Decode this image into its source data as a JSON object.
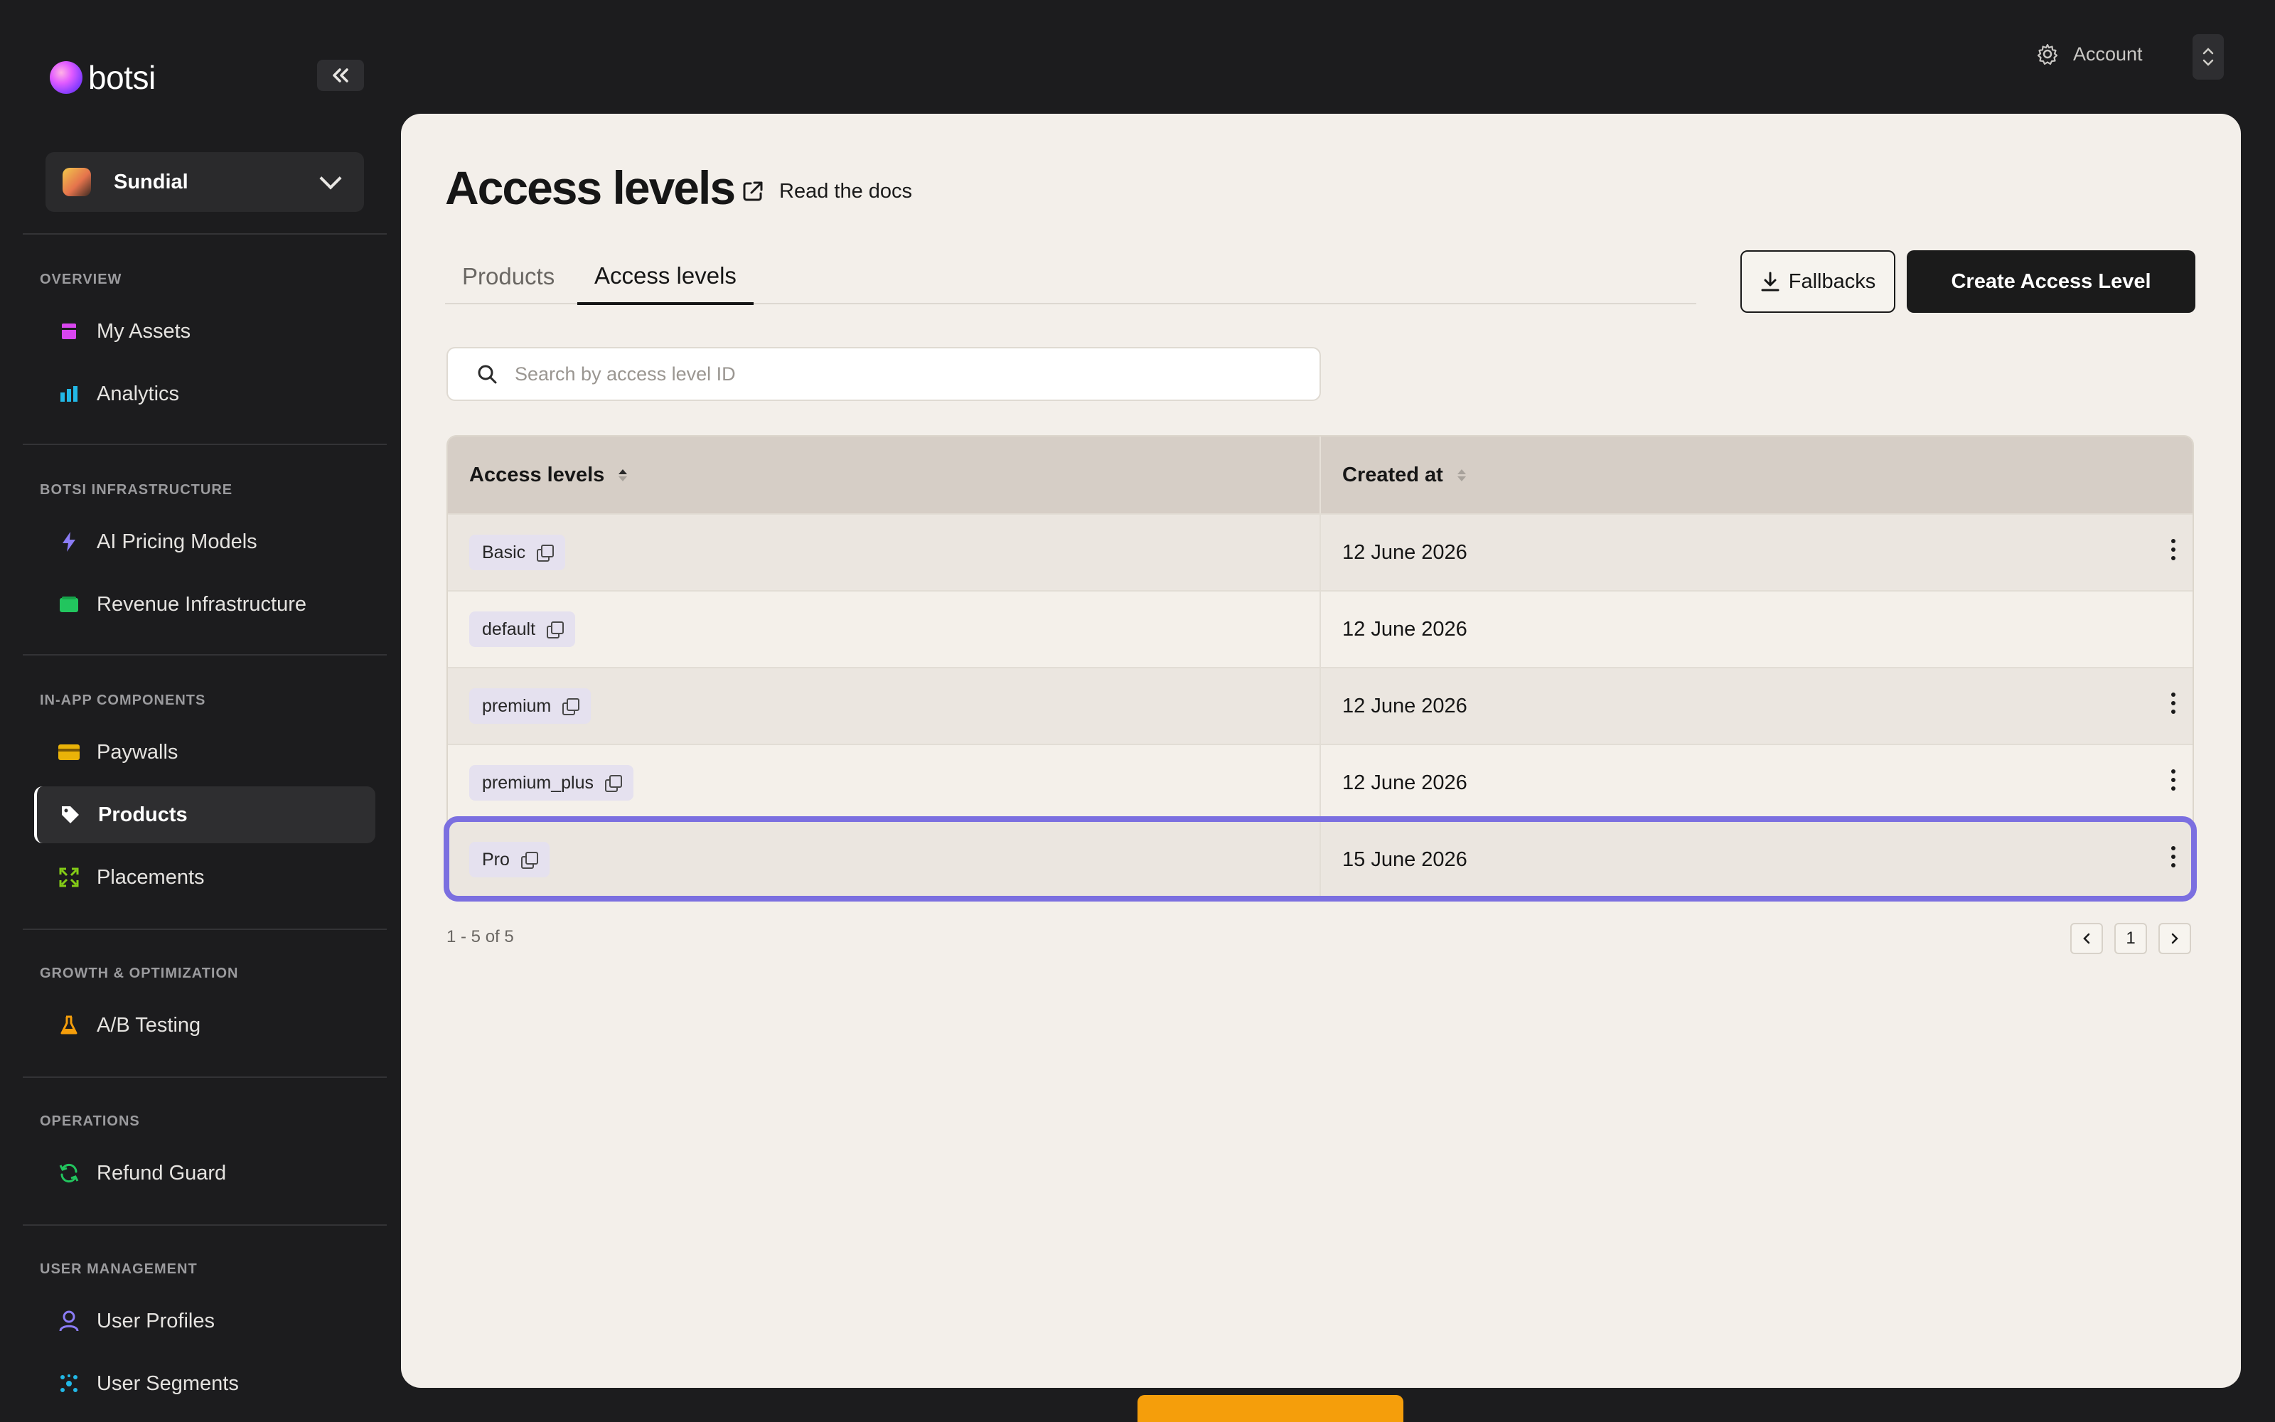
{
  "sidebar": {
    "brand": "botsi",
    "project": "Sundial",
    "sections": [
      {
        "title": "OVERVIEW",
        "items": [
          {
            "label": "My Assets",
            "icon": "assets-icon",
            "color": "#d946ef"
          },
          {
            "label": "Analytics",
            "icon": "bar-chart-icon",
            "color": "#22b8e6"
          }
        ]
      },
      {
        "title": "BOTSI INFRASTRUCTURE",
        "items": [
          {
            "label": "AI Pricing Models",
            "icon": "lightning-icon",
            "color": "#8b7cf6"
          },
          {
            "label": "Revenue Infrastructure",
            "icon": "card-icon",
            "color": "#22c55e"
          }
        ]
      },
      {
        "title": "IN-APP COMPONENTS",
        "items": [
          {
            "label": "Paywalls",
            "icon": "wallet-icon",
            "color": "#eab308"
          },
          {
            "label": "Products",
            "icon": "tag-icon",
            "color": "#ffffff"
          },
          {
            "label": "Placements",
            "icon": "expand-icon",
            "color": "#84cc16"
          }
        ]
      },
      {
        "title": "GROWTH & OPTIMIZATION",
        "items": [
          {
            "label": "A/B Testing",
            "icon": "flask-icon",
            "color": "#f59e0b"
          }
        ]
      },
      {
        "title": "OPERATIONS",
        "items": [
          {
            "label": "Refund Guard",
            "icon": "refresh-icon",
            "color": "#22c55e"
          }
        ]
      },
      {
        "title": "USER MANAGEMENT",
        "items": [
          {
            "label": "User Profiles",
            "icon": "user-icon",
            "color": "#8b7cf6"
          },
          {
            "label": "User Segments",
            "icon": "segments-icon",
            "color": "#22b8e6"
          }
        ]
      }
    ],
    "active_item": "Products"
  },
  "topbar": {
    "account_label": "Account"
  },
  "page": {
    "title": "Access levels",
    "docs_link": "Read the docs",
    "tabs": [
      {
        "label": "Products"
      },
      {
        "label": "Access levels"
      }
    ],
    "active_tab": "Access levels",
    "fallbacks_button": "Fallbacks",
    "create_button": "Create Access Level",
    "search_placeholder": "Search by access level ID"
  },
  "table": {
    "columns": [
      "Access levels",
      "Created at"
    ],
    "rows": [
      {
        "id": "Basic",
        "created": "12 June 2026",
        "has_menu": true
      },
      {
        "id": "default",
        "created": "12 June 2026",
        "has_menu": false
      },
      {
        "id": "premium",
        "created": "12 June 2026",
        "has_menu": true
      },
      {
        "id": "premium_plus",
        "created": "12 June 2026",
        "has_menu": true
      },
      {
        "id": "Pro",
        "created": "15 June 2026",
        "has_menu": true,
        "selected": true
      }
    ],
    "pagination_summary": "1 - 5 of 5",
    "current_page": "1"
  },
  "colors": {
    "accent": "#7b6fe0",
    "primary_button": "#1b1b1b",
    "bottom_bar": "#f59e0b"
  }
}
